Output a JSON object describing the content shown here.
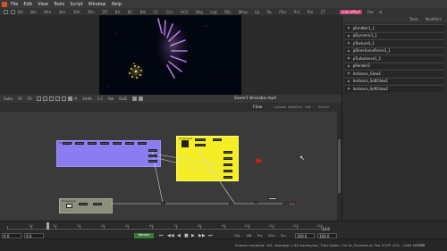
{
  "menubar": {
    "items": [
      "File",
      "Edit",
      "View",
      "Tools",
      "Script",
      "Window",
      "Help"
    ]
  },
  "toolbar": {
    "items": [
      "BG",
      "Bol",
      "Xfm",
      "3Im",
      "3Sh",
      "3Rn",
      "3Tl",
      "Blr",
      "BC",
      "Bol",
      "CC",
      "CCv",
      "HCV",
      "Mrg",
      "Lug",
      "PEv",
      "Mmp",
      "Ep",
      "Pp",
      "Pmr",
      "Rct",
      "Rle",
      "CT"
    ]
  },
  "topright": {
    "tabs": [
      "side-effect",
      "Res",
      "w"
    ]
  },
  "viewerbar": {
    "items": [
      "Subv",
      "Fit",
      "Fit"
    ],
    "letters": [
      "A",
      "Smth",
      "1:1",
      "Roi",
      "DoD"
    ],
    "title": "Saver1 Bresaba.mp4"
  },
  "flow": {
    "label": "Flow",
    "options": [
      "Console",
      "Modifiers",
      "Hist",
      "Stencil"
    ],
    "underlays": {
      "purple": "Underlay1",
      "yellow": "Underlay2",
      "grey": "Underlay3"
    }
  },
  "right_panel": {
    "tabs": [
      "Tools",
      "Modifiers"
    ],
    "rows": [
      "pEmitter1_1",
      "pDynamic1_1",
      "pTextureS_1",
      "pDirectionalForce1_1",
      "pTurbulence1_1",
      "pRender2",
      "Instance_Glow1",
      "Instance_SoftGlow1",
      "Instance_SoftGlow2"
    ]
  },
  "timeline": {
    "ruler_labels": [
      "10",
      "20",
      "30",
      "40",
      "50",
      "60",
      "70",
      "80",
      "90",
      "100",
      "110",
      "120",
      "130"
    ],
    "start": "0.0",
    "end": "100.0",
    "current": "0.0",
    "right_value": "13.0",
    "render_label": "Render",
    "transport": [
      "⏮",
      "◀◀",
      "◀",
      "■",
      "▶",
      "▶▶",
      "⏭"
    ],
    "values": [
      "HiQ",
      "MB",
      "Prx",
      "APrx",
      "Sm"
    ],
    "end_box": "100.0",
    "render_end": "100.0"
  },
  "status": {
    "text": "Frames rendered: 161, Average: 1.65 frames/sec, Time taken: 1m 9s, Finished on Tue 3:57P 47% - 1963 MB",
    "time": "Idle"
  },
  "colors": {
    "purple_underlay": "#8b7cf0",
    "yellow_underlay": "#f5ee24",
    "grey_underlay": "#8d8d7e",
    "accent_red": "#e01c1c"
  }
}
